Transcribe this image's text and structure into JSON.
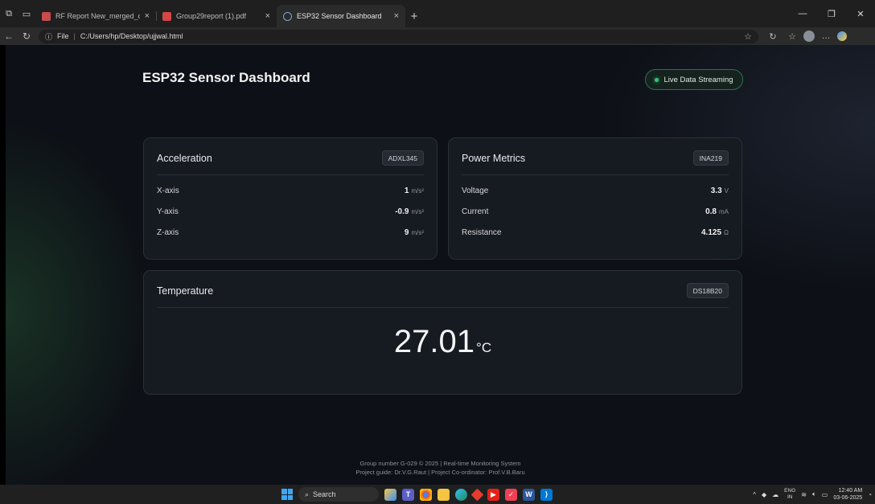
{
  "browser": {
    "tabs": [
      {
        "title": "RF Report New_merged_organiz",
        "fav_color": "#c94b4b",
        "active": false
      },
      {
        "title": "Group29report (1).pdf",
        "fav_color": "#d64545",
        "active": false
      },
      {
        "title": "ESP32 Sensor Dashboard",
        "fav_color": "#8aa2c8",
        "active": true
      }
    ],
    "address": {
      "scheme": "File",
      "url": "C:/Users/hp/Desktop/ujjwal.html"
    }
  },
  "dashboard": {
    "title": "ESP32 Sensor Dashboard",
    "status": "Live Data Streaming",
    "status_color": "#34c17b",
    "cards": {
      "acceleration": {
        "title": "Acceleration",
        "sensor": "ADXL345",
        "rows": [
          {
            "label": "X-axis",
            "value": "1",
            "unit": "m/s²"
          },
          {
            "label": "Y-axis",
            "value": "-0.9",
            "unit": "m/s²"
          },
          {
            "label": "Z-axis",
            "value": "9",
            "unit": "m/s²"
          }
        ]
      },
      "power": {
        "title": "Power Metrics",
        "sensor": "INA219",
        "rows": [
          {
            "label": "Voltage",
            "value": "3.3",
            "unit": "V"
          },
          {
            "label": "Current",
            "value": "0.8",
            "unit": "mA"
          },
          {
            "label": "Resistance",
            "value": "4.125",
            "unit": "Ω"
          }
        ]
      },
      "temperature": {
        "title": "Temperature",
        "sensor": "DS18B20",
        "value": "27.01",
        "unit": "°C"
      }
    },
    "footer": {
      "line1": "Group number G-029 © 2025 | Real-time Monitoring System",
      "line2": "Project guide: Dr.V.G.Raut | Project Co-ordinator: Prof.V.B.Baru"
    }
  },
  "taskbar": {
    "search_label": "Search",
    "lang_line1": "ENG",
    "lang_line2": "IN",
    "time": "12:40 AM",
    "date": "03-06-2025"
  }
}
